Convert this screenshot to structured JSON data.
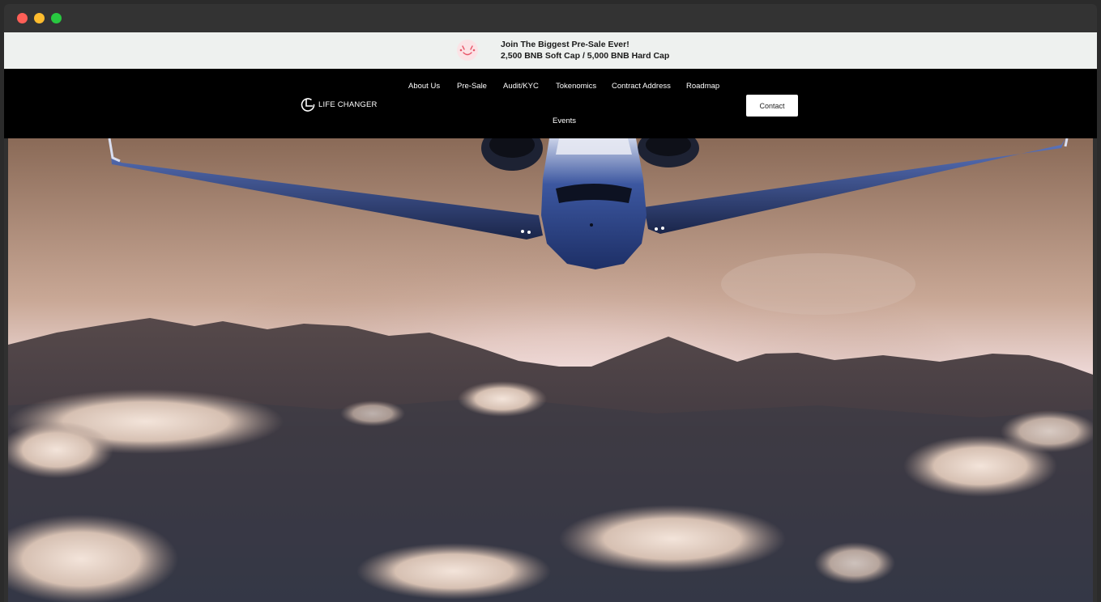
{
  "window": {
    "controls": [
      "close",
      "minimize",
      "maximize"
    ]
  },
  "announcement": {
    "icon": "smiley-face-icon",
    "line1": "Join The Biggest Pre-Sale Ever!",
    "line2": "2,500 BNB Soft Cap / 5,000 BNB Hard Cap"
  },
  "navbar": {
    "logo_text": "LIFE CHANGER",
    "links": [
      "About Us",
      "Pre-Sale",
      "Audit/KYC",
      "Tokenomics",
      "Contract Address",
      "Roadmap",
      "Events"
    ],
    "contact_label": "Contact"
  },
  "hero": {
    "image": "private-jet-over-mountains-and-clouds"
  },
  "colors": {
    "announce_bg": "#eef1ef",
    "nav_bg": "#000000",
    "accent_pink": "#e8576a"
  }
}
